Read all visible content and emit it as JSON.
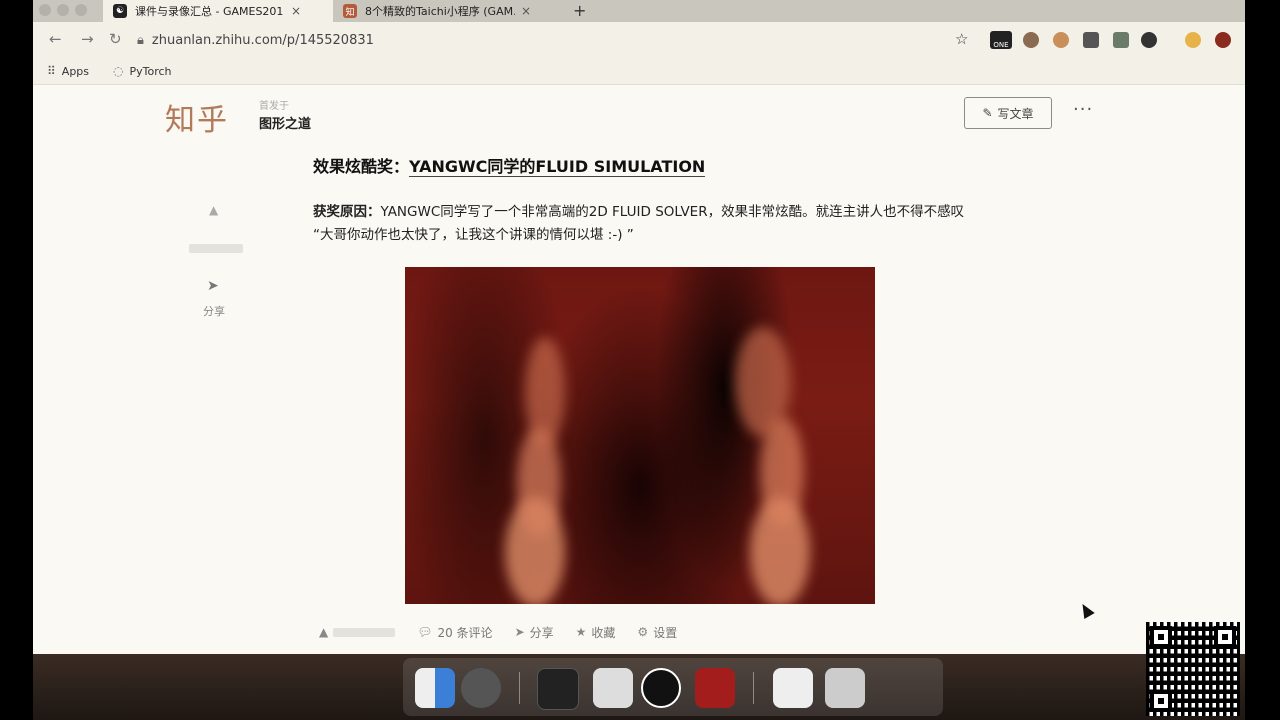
{
  "browser": {
    "tabs": [
      {
        "label": "课件与录像汇总 - GAMES201 ...",
        "favicon": "yin-yang"
      },
      {
        "label": "8个精致的Taichi小程序 (GAM...",
        "favicon": "zhihu-logo"
      }
    ],
    "new_tab": "+",
    "tab_close": "×",
    "url": "zhuanlan.zhihu.com/p/145520831",
    "bookmarks": [
      {
        "label": "Apps"
      },
      {
        "label": "PyTorch"
      }
    ],
    "extension_badge": "ONE"
  },
  "page": {
    "logo": "知乎",
    "publication_prefix": "首发于",
    "publication_name": "图形之道",
    "write_button": "写文章",
    "more": "···",
    "heading_prefix": "效果炫酷奖：",
    "heading_link": "YANGWC同学的FLUID SIMULATION",
    "paragraph_bold": "获奖原因：",
    "paragraph_text": "YANGWC同学写了一个非常高端的2D FLUID SOLVER，效果非常炫酷。就连主讲人也不得不感叹 “大哥你动作也太快了，让我这个讲课的情何以堪 :-) ”",
    "side_share": "分享",
    "bottom_actions": [
      {
        "label": "20 条评论",
        "icon": "comment-icon"
      },
      {
        "label": "分享",
        "icon": "share-icon"
      },
      {
        "label": "收藏",
        "icon": "star-icon"
      },
      {
        "label": "设置",
        "icon": "gear-icon"
      }
    ]
  },
  "colors": {
    "fluid_red": "#7a1c14",
    "plume_light": "#e8a080",
    "logo": "#b37a5a"
  }
}
